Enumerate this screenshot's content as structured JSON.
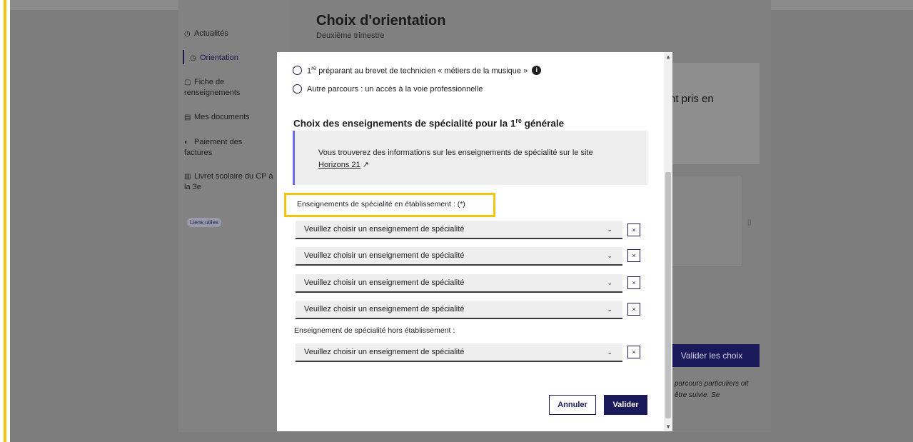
{
  "background": {
    "nav": [
      {
        "icon": "◷",
        "label": "Actualités"
      },
      {
        "icon": "◷",
        "label": "Orientation"
      },
      {
        "icon": "▢",
        "label": "Fiche de renseignements"
      },
      {
        "icon": "▤",
        "label": "Mes documents"
      },
      {
        "icon": "◐",
        "label": "Paiement des factures"
      },
      {
        "icon": "▥",
        "label": "Livret scolaire du CP à la 3e"
      }
    ],
    "liens_utiles": "Liens utiles",
    "title": "Choix d'orientation",
    "subtitle": "Deuxième trimestre",
    "card_text": "nt pris en",
    "valider_choix": "Valider les choix",
    "note": "parcours particuliers oit être suivie. Se"
  },
  "modal": {
    "radios": [
      {
        "label_prefix": "1",
        "label_sup": "re",
        "label_rest": " préparant au brevet de technicien « métiers de la musique »",
        "info": "i"
      },
      {
        "label": "Autre parcours : un accès à la voie professionnelle"
      }
    ],
    "section_title_prefix": "Choix des enseignements de spécialité pour la 1",
    "section_title_sup": "re",
    "section_title_suffix": " générale",
    "callout_text": "Vous trouverez des informations sur les enseignements de spécialité sur le site",
    "callout_link": "Horizons 21",
    "label_etab": "Enseignements de spécialité en établissement : (*)",
    "label_hors": "Enseignement de spécialité hors établissement :",
    "select_placeholder": "Veuillez choisir un enseignement de spécialité",
    "selects_etab": [
      "Veuillez choisir un enseignement de spécialité",
      "Veuillez choisir un enseignement de spécialité",
      "Veuillez choisir un enseignement de spécialité",
      "Veuillez choisir un enseignement de spécialité"
    ],
    "select_hors": "Veuillez choisir un enseignement de spécialité",
    "remove_symbol": "×",
    "cancel": "Annuler",
    "submit": "Valider"
  },
  "colors": {
    "highlight": "#f1c40f",
    "primary": "#1a1a5a",
    "callout_border": "#6a6af4"
  }
}
